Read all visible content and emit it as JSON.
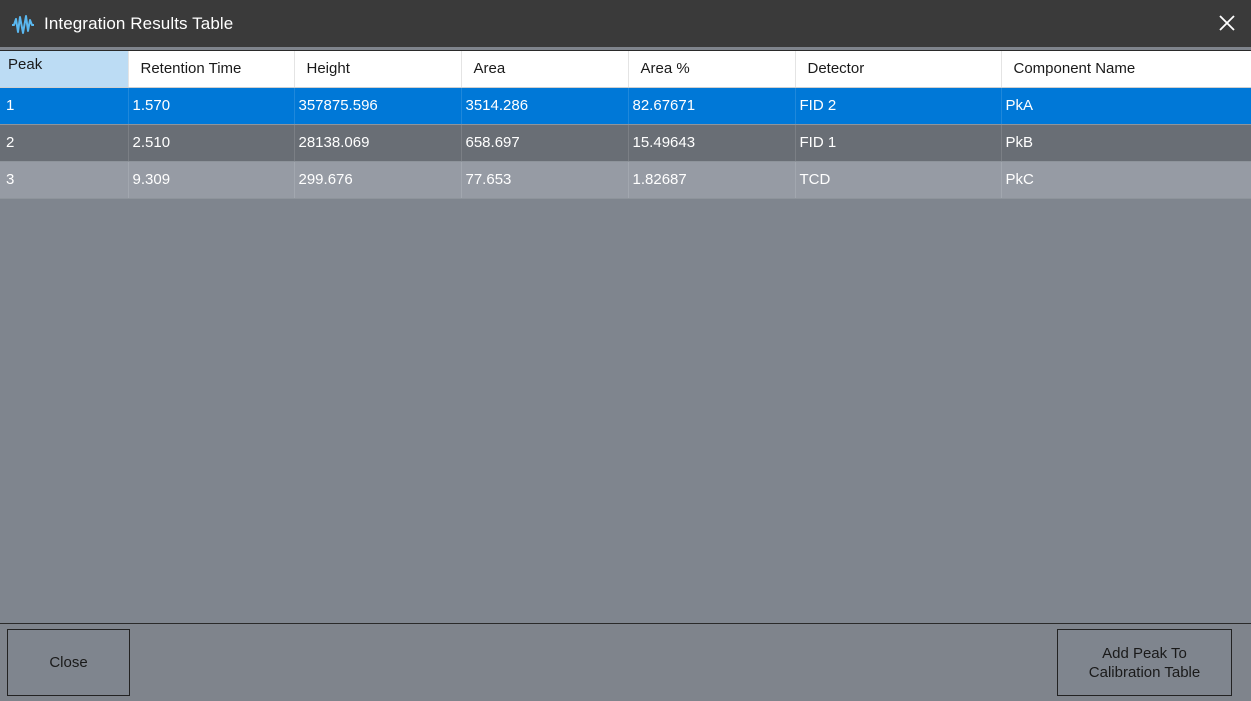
{
  "window": {
    "title": "Integration Results Table",
    "icon": "waveform-icon",
    "close_icon": "close-icon"
  },
  "table": {
    "columns": [
      "Peak",
      "Retention Time",
      "Height",
      "Area",
      "Area %",
      "Detector",
      "Component Name"
    ],
    "rows": [
      [
        "1",
        "1.570",
        "357875.596",
        "3514.286",
        "82.67671",
        "FID 2",
        "PkA"
      ],
      [
        "2",
        "2.510",
        "28138.069",
        "658.697",
        "15.49643",
        "FID 1",
        "PkB"
      ],
      [
        "3",
        "9.309",
        "299.676",
        "77.653",
        "1.82687",
        "TCD",
        "PkC"
      ]
    ],
    "selected_row": 1
  },
  "buttons": {
    "close_label": "Close",
    "add_peak_line1": "Add Peak To",
    "add_peak_line2": "Calibration Table"
  },
  "colors": {
    "titlebar": "#3a3a3a",
    "selection": "#0078d7",
    "background": "#7f848c",
    "header_selected": "#bcdcf4"
  }
}
